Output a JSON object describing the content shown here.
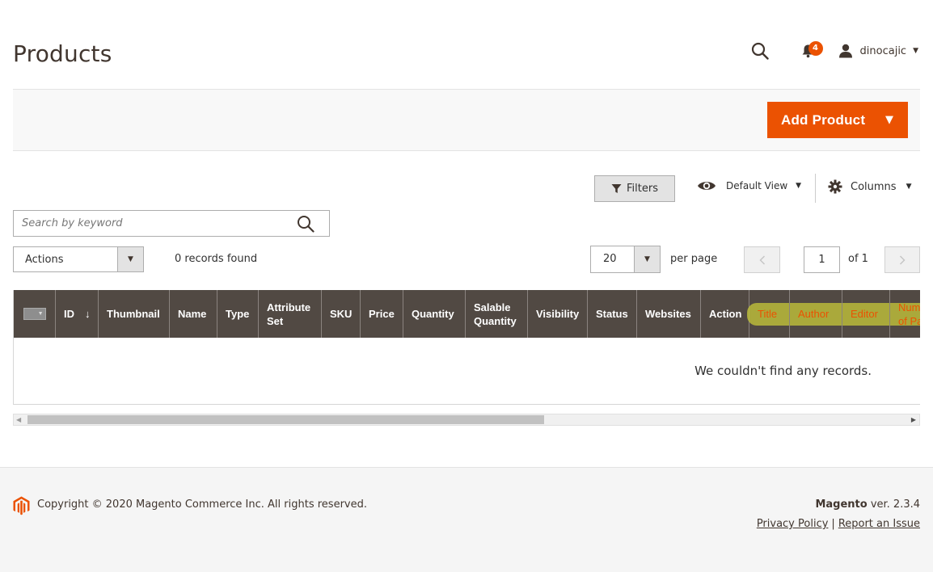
{
  "page": {
    "title": "Products"
  },
  "header": {
    "notifications_count": "4",
    "username": "dinocajic"
  },
  "toolbar": {
    "add_product_label": "Add Product"
  },
  "grid_controls": {
    "filters_label": "Filters",
    "view_label": "Default View",
    "columns_label": "Columns",
    "search_placeholder": "Search by keyword",
    "actions_label": "Actions",
    "records_found": "0 records found",
    "per_page_value": "20",
    "per_page_label": "per page",
    "current_page": "1",
    "of_pages": "of 1"
  },
  "grid": {
    "columns": [
      {
        "label": "ID",
        "sorted": "↓"
      },
      {
        "label": "Thumbnail"
      },
      {
        "label": "Name"
      },
      {
        "label": "Type"
      },
      {
        "label": "Attribute Set"
      },
      {
        "label": "SKU"
      },
      {
        "label": "Price"
      },
      {
        "label": "Quantity"
      },
      {
        "label": "Salable Quantity"
      },
      {
        "label": "Visibility"
      },
      {
        "label": "Status"
      },
      {
        "label": "Websites"
      },
      {
        "label": "Action"
      },
      {
        "label": "Title",
        "highlighted": true
      },
      {
        "label": "Author",
        "highlighted": true
      },
      {
        "label": "Editor",
        "highlighted": true
      },
      {
        "label": "Number of Pages",
        "highlighted": true
      }
    ],
    "empty_message": "We couldn't find any records.",
    "highlight_color": "#c3c43a"
  },
  "footer": {
    "copyright": "Copyright © 2020 Magento Commerce Inc. All rights reserved.",
    "brand": "Magento",
    "version": "ver. 2.3.4",
    "privacy_link": "Privacy Policy",
    "separator": "|",
    "report_link": "Report an Issue"
  },
  "colors": {
    "accent": "#eb5202",
    "grid_header_bg": "#514943"
  }
}
